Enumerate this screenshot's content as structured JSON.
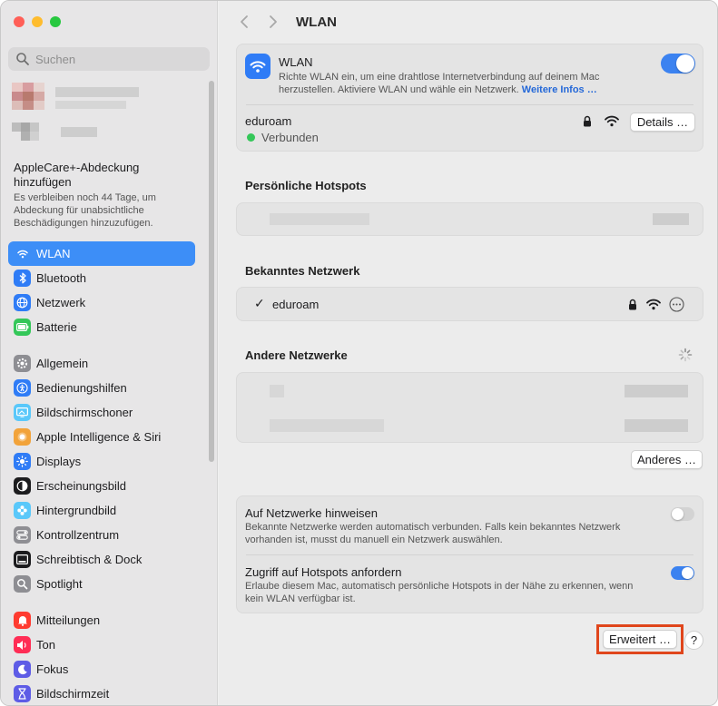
{
  "window": {
    "title": "WLAN"
  },
  "search": {
    "placeholder": "Suchen"
  },
  "applecare": {
    "title": "AppleCare+-Abdeckung hinzufügen",
    "subtitle": "Es verbleiben noch 44 Tage, um Abdeckung für unabsichtliche Beschädigungen hinzuzufügen."
  },
  "sidebar": {
    "groups": [
      [
        {
          "label": "WLAN",
          "icon": "wifi-icon",
          "color": "#3d8ef7",
          "active": true
        },
        {
          "label": "Bluetooth",
          "icon": "bluetooth-icon",
          "color": "#2f7cf6"
        },
        {
          "label": "Netzwerk",
          "icon": "globe-icon",
          "color": "#2f7cf6"
        },
        {
          "label": "Batterie",
          "icon": "battery-icon",
          "color": "#34c759"
        }
      ],
      [
        {
          "label": "Allgemein",
          "icon": "gear-icon",
          "color": "#8e8e93"
        },
        {
          "label": "Bedienungshilfen",
          "icon": "accessibility-icon",
          "color": "#2f7cf6"
        },
        {
          "label": "Bildschirmschoner",
          "icon": "screensaver-icon",
          "color": "#5ac8fa"
        },
        {
          "label": "Apple Intelligence & Siri",
          "icon": "siri-icon",
          "color": "#f2a33a"
        },
        {
          "label": "Displays",
          "icon": "sun-icon",
          "color": "#2f7cf6"
        },
        {
          "label": "Erscheinungsbild",
          "icon": "appearance-icon",
          "color": "#1c1c1e"
        },
        {
          "label": "Hintergrundbild",
          "icon": "flower-icon",
          "color": "#5ac8fa"
        },
        {
          "label": "Kontrollzentrum",
          "icon": "control-center-icon",
          "color": "#8e8e93"
        },
        {
          "label": "Schreibtisch & Dock",
          "icon": "dock-icon",
          "color": "#1c1c1e"
        },
        {
          "label": "Spotlight",
          "icon": "magnifier-icon",
          "color": "#8e8e93"
        }
      ],
      [
        {
          "label": "Mitteilungen",
          "icon": "bell-icon",
          "color": "#ff3b30"
        },
        {
          "label": "Ton",
          "icon": "speaker-icon",
          "color": "#ff2d55"
        },
        {
          "label": "Fokus",
          "icon": "moon-icon",
          "color": "#5e5ce6"
        },
        {
          "label": "Bildschirmzeit",
          "icon": "hourglass-icon",
          "color": "#5e5ce6"
        }
      ]
    ]
  },
  "wlan": {
    "title": "WLAN",
    "description": "Richte WLAN ein, um eine drahtlose Internetverbindung auf deinem Mac herzustellen. Aktiviere WLAN und wähle ein Netzwerk.",
    "more_link": "Weitere Infos …",
    "enabled": true,
    "current_network": "eduroam",
    "status": "Verbunden",
    "details_button": "Details …"
  },
  "sections": {
    "hotspots": "Persönliche Hotspots",
    "known": "Bekanntes Netzwerk",
    "known_network": "eduroam",
    "other": "Andere Netzwerke",
    "other_button": "Anderes …"
  },
  "settings": {
    "ask_title": "Auf Netzwerke hinweisen",
    "ask_desc": "Bekannte Netzwerke werden automatisch verbunden. Falls kein bekanntes Netzwerk vorhanden ist, musst du manuell ein Netzwerk auswählen.",
    "ask_enabled": false,
    "hotspot_title": "Zugriff auf Hotspots anfordern",
    "hotspot_desc": "Erlaube diesem Mac, automatisch persönliche Hotspots in der Nähe zu erkennen, wenn kein WLAN verfügbar ist.",
    "hotspot_enabled": true
  },
  "footer": {
    "advanced_button": "Erweitert …",
    "help": "?"
  },
  "colors": {
    "accent": "#3b82f0",
    "highlight_box": "#e0461c",
    "connected": "#34c759"
  }
}
